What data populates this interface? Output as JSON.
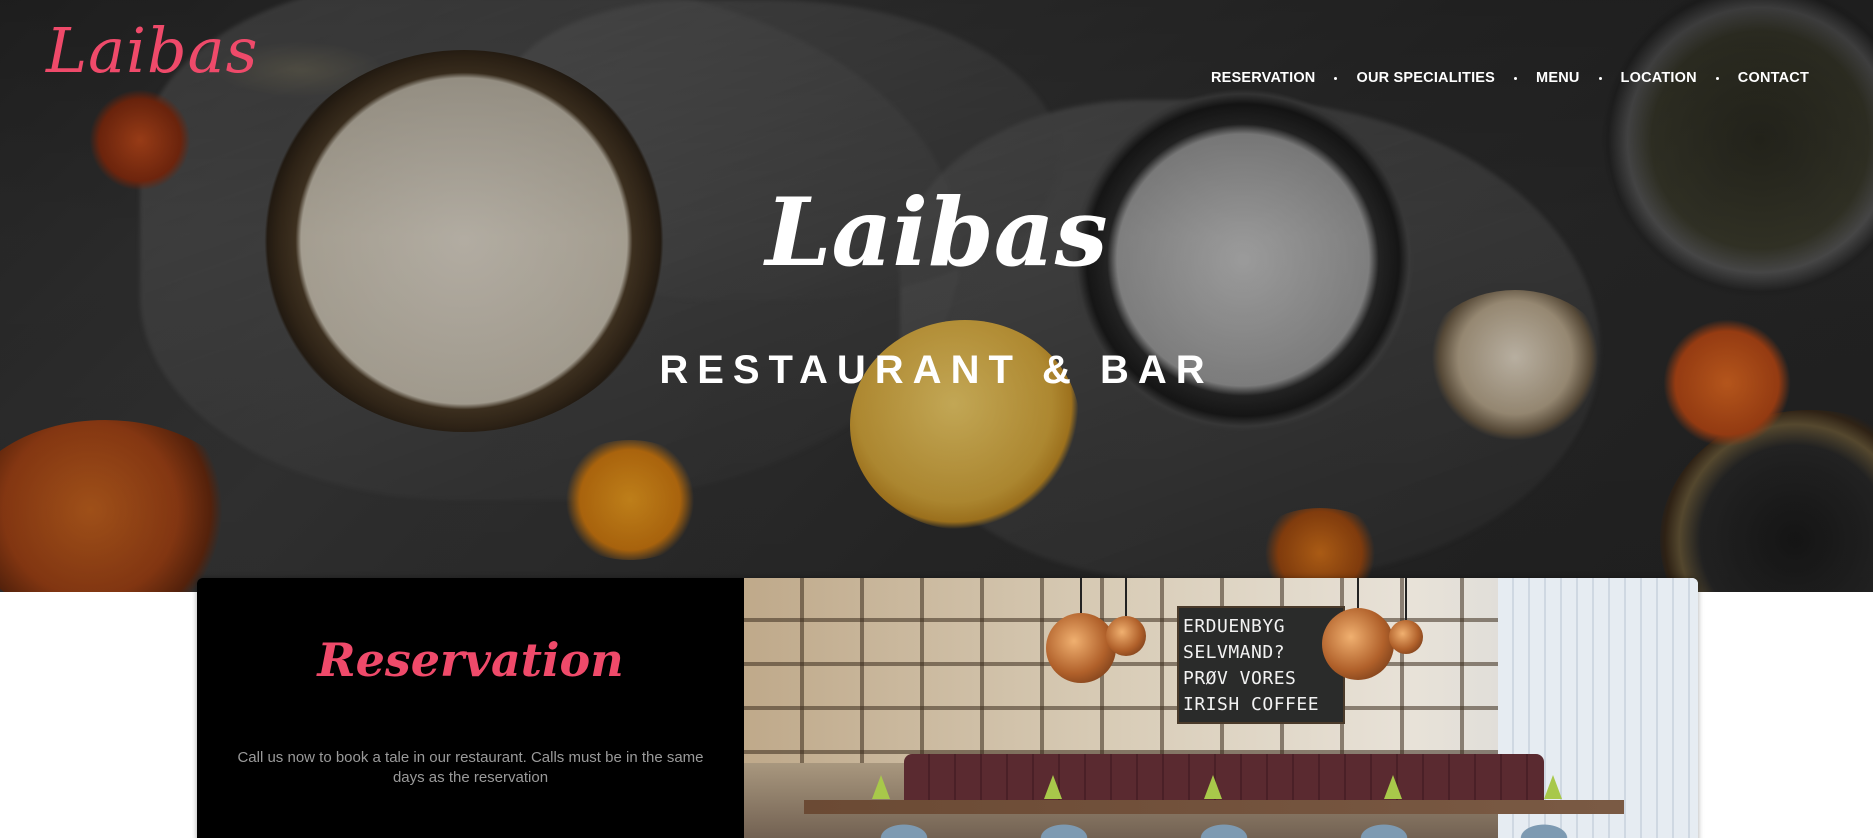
{
  "brand": {
    "logo_text": "Laibas",
    "accent_color": "#ef4a6a"
  },
  "nav": {
    "items": [
      {
        "label": "RESERVATION"
      },
      {
        "label": "OUR SPECIALITIES"
      },
      {
        "label": "MENU"
      },
      {
        "label": "LOCATION"
      },
      {
        "label": "CONTACT"
      }
    ]
  },
  "hero": {
    "title": "Laibas",
    "subtitle": "RESTAURANT & BAR"
  },
  "reservation": {
    "title": "Reservation",
    "text": "Call us now to book a tale in our restaurant. Calls must be in the same days as the reservation",
    "photo": {
      "chalkboard_lines": [
        "ERDUENBYG",
        "SELVMAND?",
        "PRØV VORES",
        "IRISH COFFEE"
      ]
    }
  }
}
